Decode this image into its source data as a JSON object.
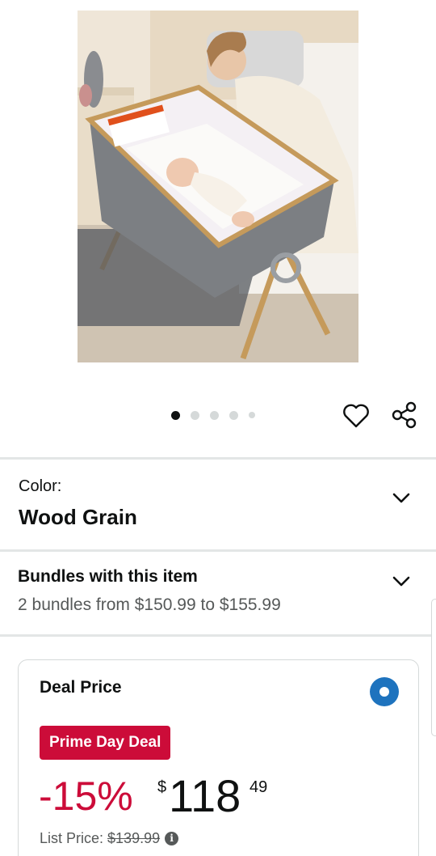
{
  "image": {
    "alt": ""
  },
  "carousel": {
    "total": 5,
    "active": 1
  },
  "color": {
    "label": "Color:",
    "value": "Wood Grain"
  },
  "bundles": {
    "title": "Bundles with this item",
    "subtitle": "2 bundles from $150.99 to $155.99"
  },
  "deal": {
    "title": "Deal Price",
    "badge": "Prime Day Deal",
    "discount": "-15%",
    "currency": "$",
    "price_whole": "118",
    "price_fraction": "49",
    "list_price_label": "List Price:",
    "list_price_value": "$139.99",
    "info_icon": "i"
  },
  "colors": {
    "deal_red": "#cc0c39",
    "radio_blue": "#1e73be",
    "divider": "#e3e6e6"
  }
}
